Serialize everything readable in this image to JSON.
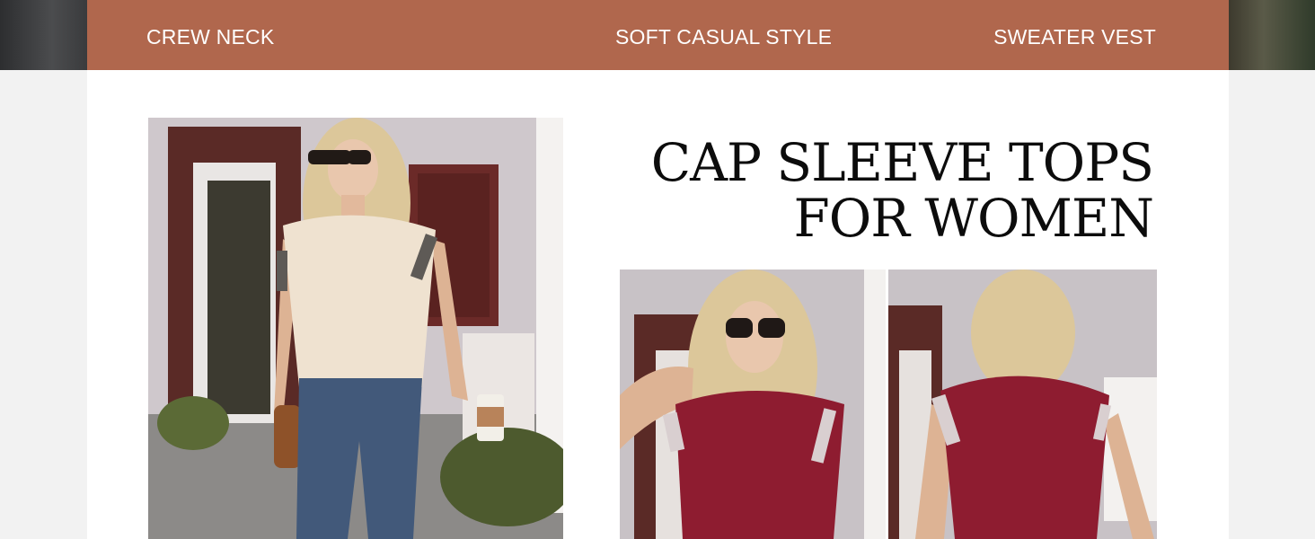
{
  "features": [
    "CREW NECK",
    "SOFT CASUAL STYLE",
    "SWEATER VEST"
  ],
  "heading": {
    "line1": "CAP SLEEVE TOPS",
    "line2": "FOR WOMEN"
  },
  "colors": {
    "banner": "#b0674d",
    "top_cream": "#efe2d0",
    "top_burgundy": "#8e1c30",
    "jeans": "#42597a"
  }
}
